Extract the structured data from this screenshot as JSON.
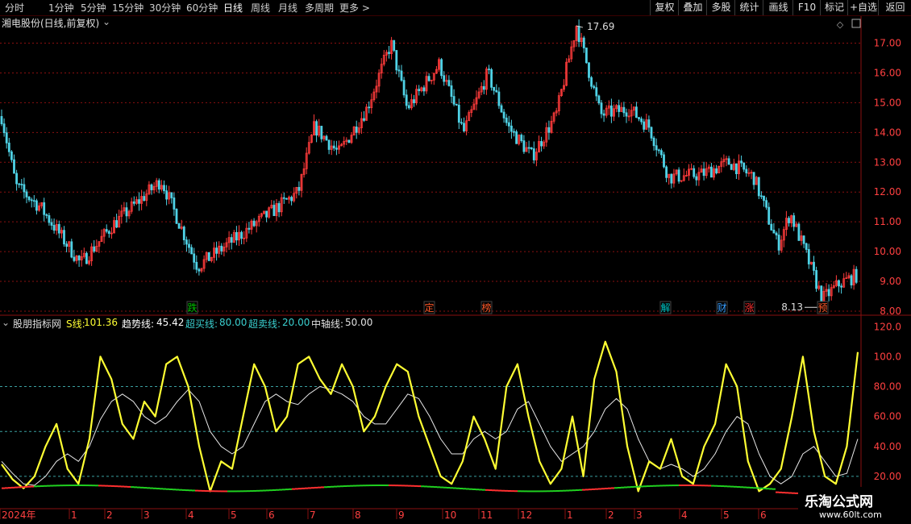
{
  "toolbar": {
    "timeframes": [
      "分时",
      "1分钟",
      "5分钟",
      "15分钟",
      "30分钟",
      "60分钟",
      "日线",
      "周线",
      "月线",
      "多周期",
      "更多 >"
    ],
    "active_timeframe": "日线",
    "buttons": [
      "复权",
      "叠加",
      "多股",
      "统计",
      "画线",
      "F10",
      "标记",
      "+自选",
      "返回"
    ]
  },
  "price_panel": {
    "title": "湘电股份(日线,前复权)",
    "high_label": "17.69",
    "low_label": "8.13",
    "y_ticks": [
      "17.00",
      "16.00",
      "15.00",
      "14.00",
      "13.00",
      "12.00",
      "11.00",
      "10.00",
      "9.00",
      "8.00"
    ],
    "event_badges": [
      {
        "text": "跌",
        "color": "#00c000"
      },
      {
        "text": "定",
        "color": "#ff5a2a"
      },
      {
        "text": "榜",
        "color": "#ff5a2a"
      },
      {
        "text": "解",
        "color": "#00c8c8"
      },
      {
        "text": "财",
        "color": "#3aa0ff"
      },
      {
        "text": "涨",
        "color": "#ff3030"
      },
      {
        "text": "预",
        "color": "#ff5a2a"
      }
    ]
  },
  "indicator_panel": {
    "name": "股朋指标网",
    "s_label": "S线:",
    "s_value": "101.36",
    "trend_label": "趋势线:",
    "trend_value": "45.42",
    "overbought_label": "超买线:",
    "overbought_value": "80.00",
    "oversold_label": "超卖线:",
    "oversold_value": "20.00",
    "axis_label": "中轴线:",
    "axis_value": "50.00",
    "y_ticks": [
      "120.0",
      "100.0",
      "80.00",
      "60.00",
      "40.00",
      "20.00"
    ],
    "levels": {
      "overbought": 80,
      "axis": 50,
      "oversold": 20
    }
  },
  "x_axis": {
    "labels": [
      "2024年",
      "1",
      "2",
      "3",
      "4",
      "5",
      "6",
      "7",
      "8",
      "9",
      "10",
      "11",
      "12",
      "1",
      "2",
      "3",
      "4",
      "5",
      "6"
    ]
  },
  "watermark": {
    "title": "乐淘公式网",
    "url": "www.60lt.com"
  },
  "colors": {
    "up": "#ff3b3b",
    "down": "#4fd2e6",
    "s_line": "#ffff33",
    "trend_line": "#e8e8e8",
    "grid": "#8a1010",
    "level": "#3aa0a0",
    "axis_text": "#ff4040"
  },
  "chart_data": {
    "type": "line",
    "title": "湘电股份(日线,前复权)",
    "series": [
      {
        "name": "S线",
        "values": [
          28,
          18,
          12,
          20,
          40,
          55,
          25,
          15,
          45,
          100,
          85,
          55,
          45,
          70,
          60,
          95,
          100,
          80,
          40,
          10,
          30,
          25,
          60,
          95,
          80,
          50,
          60,
          95,
          100,
          85,
          75,
          95,
          80,
          50,
          60,
          80,
          95,
          90,
          60,
          40,
          20,
          15,
          30,
          60,
          45,
          25,
          80,
          95,
          60,
          30,
          15,
          25,
          60,
          20,
          85,
          110,
          90,
          40,
          10,
          30,
          25,
          45,
          20,
          15,
          40,
          55,
          95,
          80,
          30,
          10,
          15,
          25,
          60,
          100,
          50,
          20,
          15,
          40,
          103
        ]
      },
      {
        "name": "趋势线",
        "values": [
          30,
          22,
          15,
          14,
          20,
          30,
          35,
          30,
          40,
          58,
          70,
          75,
          70,
          60,
          55,
          60,
          70,
          78,
          70,
          50,
          40,
          35,
          40,
          55,
          70,
          75,
          70,
          68,
          75,
          80,
          78,
          75,
          70,
          60,
          55,
          55,
          65,
          75,
          72,
          60,
          45,
          35,
          35,
          45,
          50,
          45,
          50,
          65,
          70,
          55,
          40,
          30,
          35,
          40,
          50,
          65,
          72,
          65,
          45,
          30,
          25,
          28,
          25,
          20,
          25,
          35,
          50,
          60,
          55,
          35,
          20,
          15,
          20,
          35,
          40,
          30,
          20,
          22,
          45
        ]
      },
      {
        "name": "中轴线",
        "values": [
          50
        ]
      },
      {
        "name": "超买线",
        "values": [
          80
        ]
      },
      {
        "name": "超卖线",
        "values": [
          20
        ]
      }
    ],
    "price": {
      "high": 17.69,
      "low": 8.13,
      "ylim": [
        8,
        17.8
      ]
    },
    "indicator_ylim": [
      0,
      125
    ]
  }
}
